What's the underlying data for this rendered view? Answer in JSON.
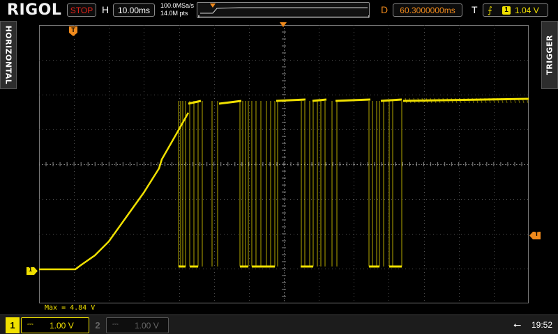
{
  "brand": "RIGOL",
  "run_status": "STOP",
  "horizontal": {
    "label": "H",
    "scale": "10.00ms",
    "sample_rate": "100.0MSa/s",
    "memory_depth": "14.0M pts"
  },
  "delay": {
    "label": "D",
    "value": "60.3000000ms"
  },
  "trigger": {
    "label": "T",
    "edge_icon": "rising-edge-icon",
    "source": "1",
    "level": "1.04 V"
  },
  "side_tabs": {
    "left": "HORIZONTAL",
    "right": "TRIGGER"
  },
  "channel_marker": "1",
  "trigger_marker": "T",
  "measurement": "Max = 4.84 V",
  "channels": [
    {
      "num": "1",
      "coupling": "⎓",
      "scale": "1.00 V",
      "active": true,
      "color": "#f0e000"
    },
    {
      "num": "2",
      "coupling": "⎓",
      "scale": "1.00 V",
      "active": false,
      "color": "#666666"
    }
  ],
  "clock": "19:52",
  "usb_icon": "usb-icon",
  "colors": {
    "ch1": "#f0e000",
    "trigger": "#f08a1c",
    "stop": "#e2231a",
    "grid": "#555555"
  },
  "waveform": {
    "volts_per_div": 1.0,
    "time_per_div_ms": 10.0,
    "baseline_v": 0.0,
    "high_v": 4.84,
    "trigger_level_v": 1.04
  }
}
